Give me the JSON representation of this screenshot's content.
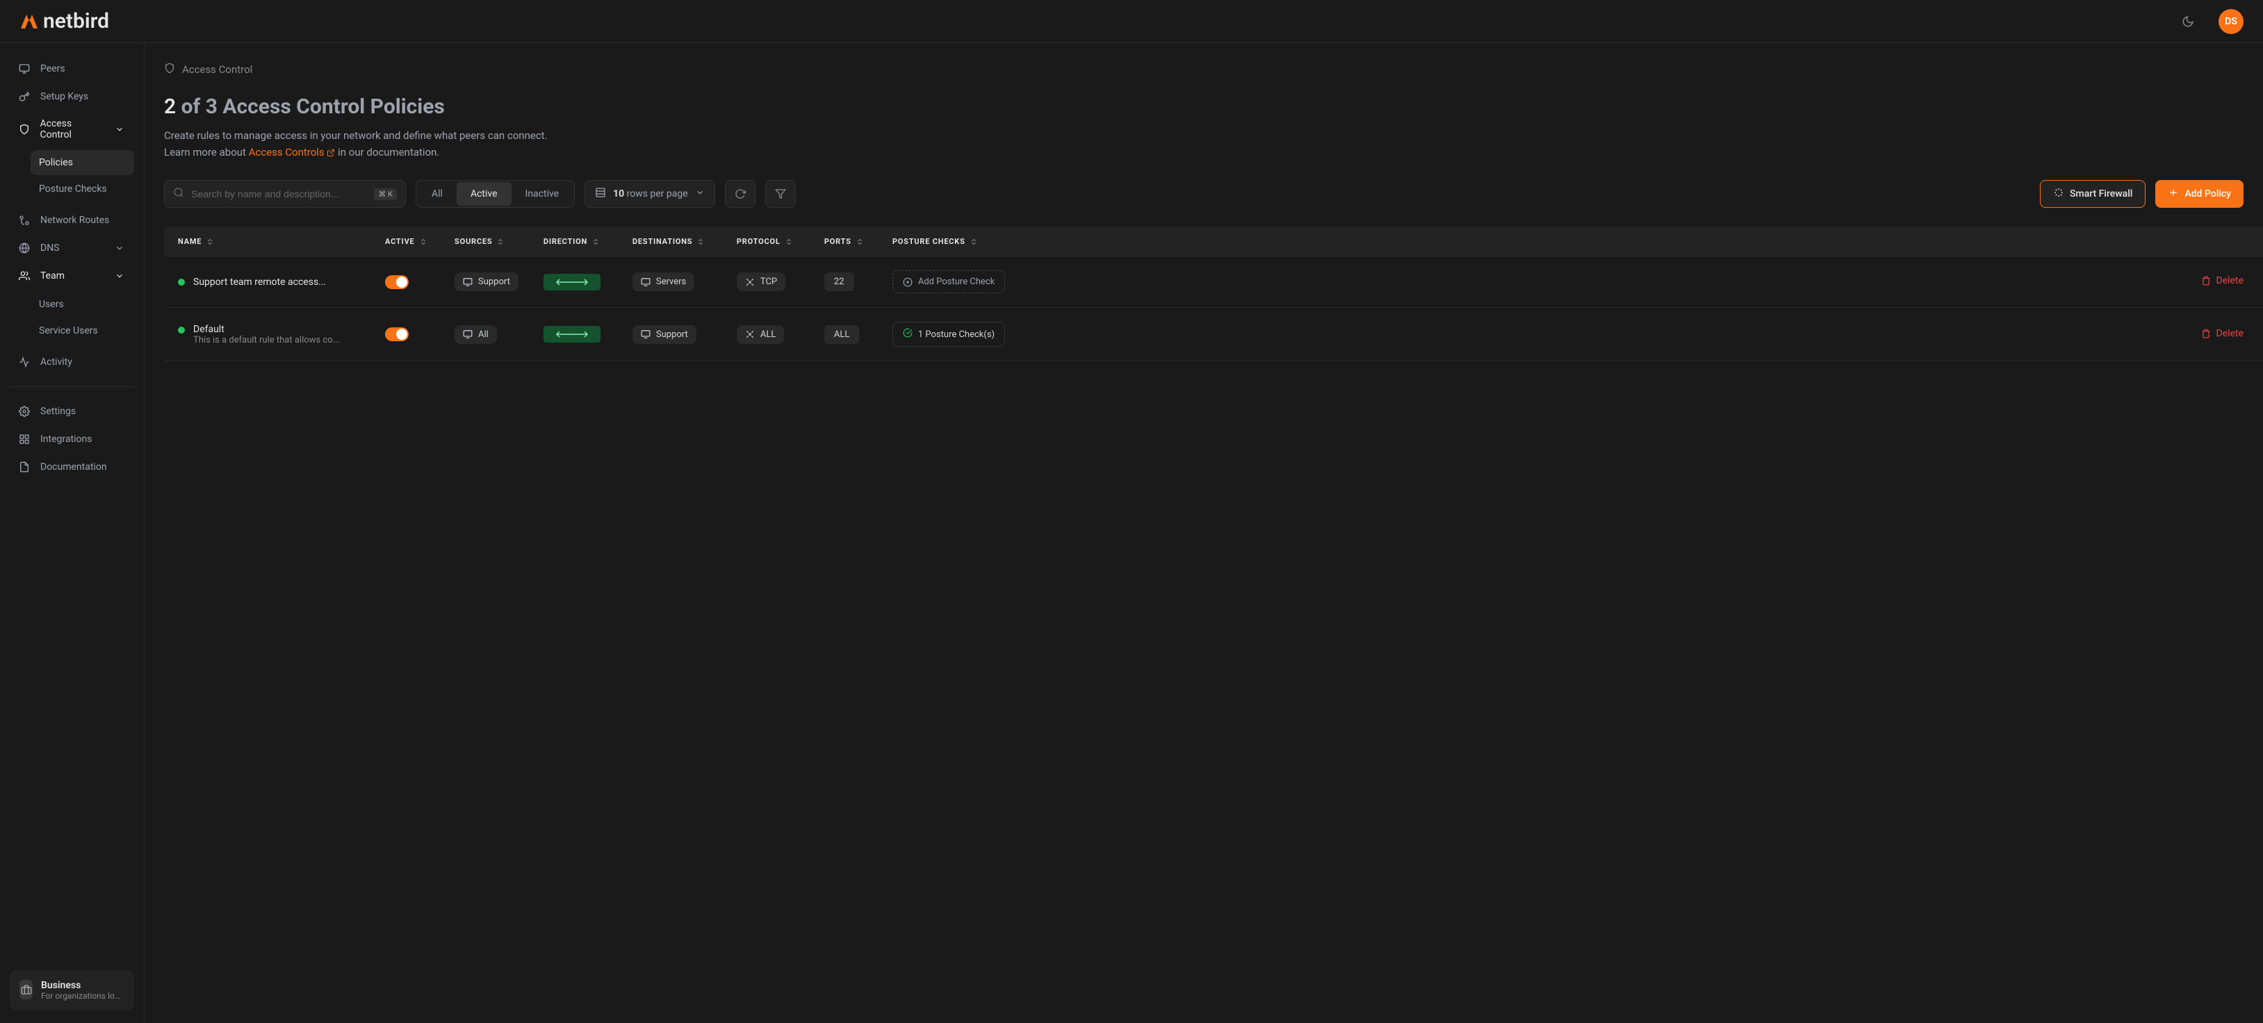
{
  "brand": "netbird",
  "avatar": "DS",
  "sidebar": {
    "peers": "Peers",
    "setup_keys": "Setup Keys",
    "access_control": "Access Control",
    "policies": "Policies",
    "posture_checks": "Posture Checks",
    "network_routes": "Network Routes",
    "dns": "DNS",
    "team": "Team",
    "users": "Users",
    "service_users": "Service Users",
    "activity": "Activity",
    "settings": "Settings",
    "integrations": "Integrations",
    "documentation": "Documentation"
  },
  "plan": {
    "title": "Business",
    "subtitle": "For organizations looki..."
  },
  "breadcrumb": "Access Control",
  "heading": {
    "count": "2",
    "rest": " of 3 Access Control Policies"
  },
  "desc": {
    "line1": "Create rules to manage access in your network and define what peers can connect.",
    "line2a": "Learn more about ",
    "link": "Access Controls",
    "line2b": " in our documentation."
  },
  "search": {
    "placeholder": "Search by name and description...",
    "kbd": "⌘ K"
  },
  "filter": {
    "all": "All",
    "active": "Active",
    "inactive": "Inactive"
  },
  "pagination": {
    "count": "10",
    "label": " rows per page"
  },
  "actions": {
    "smart_firewall": "Smart Firewall",
    "add_policy": "Add Policy"
  },
  "columns": {
    "name": "NAME",
    "active": "ACTIVE",
    "sources": "SOURCES",
    "direction": "DIRECTION",
    "destinations": "DESTINATIONS",
    "protocol": "PROTOCOL",
    "ports": "PORTS",
    "posture": "POSTURE CHECKS"
  },
  "posture_add_label": "Add Posture Check",
  "delete_label": "Delete",
  "rows": [
    {
      "name": "Support team remote access...",
      "desc": "",
      "source": "Support",
      "destination": "Servers",
      "protocol": "TCP",
      "ports": "22",
      "posture_label": "Add Posture Check",
      "posture_type": "add"
    },
    {
      "name": "Default",
      "desc": "This is a default rule that allows co...",
      "source": "All",
      "destination": "Support",
      "protocol": "ALL",
      "ports": "ALL",
      "posture_label": "1 Posture Check(s)",
      "posture_type": "count"
    }
  ]
}
